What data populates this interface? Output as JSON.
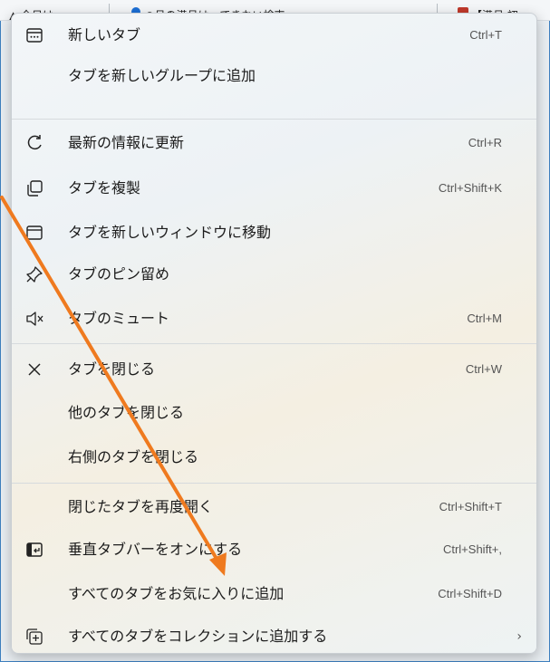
{
  "tabstrip": {
    "tabs": [
      {
        "label": "▲ 今日は"
      },
      {
        "label": "○月の満月は…できない検索"
      },
      {
        "label": "【満月 初"
      }
    ]
  },
  "menu": {
    "items": [
      {
        "label": "新しいタブ",
        "shortcut": "Ctrl+T",
        "icon": "new-tab-icon"
      },
      {
        "label": "タブを新しいグループに追加",
        "shortcut": "",
        "icon": ""
      },
      {
        "label": "最新の情報に更新",
        "shortcut": "Ctrl+R",
        "icon": "refresh-icon"
      },
      {
        "label": "タブを複製",
        "shortcut": "Ctrl+Shift+K",
        "icon": "duplicate-icon"
      },
      {
        "label": "タブを新しいウィンドウに移動",
        "shortcut": "",
        "icon": "window-icon"
      },
      {
        "label": "タブのピン留め",
        "shortcut": "",
        "icon": "pin-icon"
      },
      {
        "label": "タブのミュート",
        "shortcut": "Ctrl+M",
        "icon": "mute-icon"
      },
      {
        "label": "タブを閉じる",
        "shortcut": "Ctrl+W",
        "icon": "close-icon"
      },
      {
        "label": "他のタブを閉じる",
        "shortcut": "",
        "icon": ""
      },
      {
        "label": "右側のタブを閉じる",
        "shortcut": "",
        "icon": ""
      },
      {
        "label": "閉じたタブを再度開く",
        "shortcut": "Ctrl+Shift+T",
        "icon": ""
      },
      {
        "label": "垂直タブバーをオンにする",
        "shortcut": "Ctrl+Shift+,",
        "icon": "vertical-tabs-icon"
      },
      {
        "label": "すべてのタブをお気に入りに追加",
        "shortcut": "Ctrl+Shift+D",
        "icon": ""
      },
      {
        "label": "すべてのタブをコレクションに追加する",
        "shortcut": "",
        "submenu": "›",
        "icon": "collections-icon"
      }
    ]
  },
  "colors": {
    "accent_arrow": "#ef7a1f",
    "border_blue": "#3d7fbf"
  }
}
